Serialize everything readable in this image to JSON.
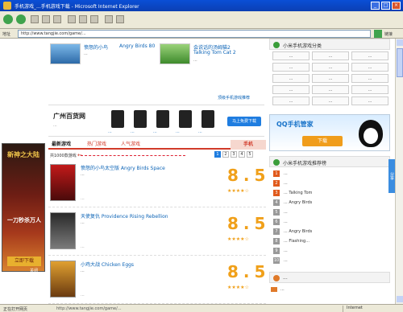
{
  "window": {
    "title": "手机游戏_...手机游戏下载 - Microsoft Internet Explorer",
    "controls": [
      "_",
      "□",
      "×"
    ]
  },
  "address": {
    "label": "地址",
    "url": "http://www.tangjie.com/game/...",
    "links": "链接"
  },
  "left_ad": {
    "logo": "新神之大陆",
    "slogan": "一刀秒杀万人",
    "cta": "立即下载",
    "close": "关闭"
  },
  "top_row": [
    {
      "title": "愤怒的小鸟",
      "subtitle": "Angry Birds 80",
      "desc": "..."
    },
    {
      "title": "会说话的汤姆猫2",
      "subtitle": "Talking Tom Cat 2",
      "desc": "..."
    }
  ],
  "mobile_link": "顶级手机游戏推荐",
  "banner": {
    "brand": "广州百货网",
    "brand_sub": "...",
    "prices": [
      "...",
      "...",
      "...",
      "...",
      "..."
    ],
    "cta": "马上免费下载"
  },
  "tabs": {
    "items": [
      "最新游戏",
      "热门游戏",
      "人气游戏"
    ],
    "active_index": 0,
    "right_label": "手机"
  },
  "pager": {
    "label": "共1000款游戏",
    "pages": [
      "1",
      "2",
      "3",
      "4",
      "5"
    ],
    "active_page": "1"
  },
  "entries": [
    {
      "title": "愤怒的小鸟太空版 Angry Birds Space",
      "desc": "...",
      "meta": "...",
      "score": "8.5",
      "stars": "★★★★☆"
    },
    {
      "title": "天使复仇 Providence Rising Rebellion",
      "desc": "...",
      "meta": "...",
      "score": "8.5",
      "stars": "★★★★☆"
    },
    {
      "title": "小鸡大战 Chicken Eggs",
      "desc": "...",
      "meta": "...",
      "score": "8.5",
      "stars": "★★★★☆"
    }
  ],
  "right_col": {
    "category_head": "小米手机游戏分类",
    "categories": [
      "...",
      "...",
      "...",
      "...",
      "...",
      "...",
      "...",
      "...",
      "...",
      "...",
      "...",
      "...",
      "...",
      "...",
      "..."
    ],
    "qq_ad": {
      "title": "QQ手机管家",
      "cta": "下载"
    },
    "recommend_head": "小米手机游戏推荐榜",
    "recommend": [
      {
        "n": "1",
        "name": "..."
      },
      {
        "n": "2",
        "name": "..."
      },
      {
        "n": "3",
        "name": "... Talking Tom"
      },
      {
        "n": "4",
        "name": "... Angry Birds"
      },
      {
        "n": "5",
        "name": "..."
      },
      {
        "n": "6",
        "name": "..."
      },
      {
        "n": "7",
        "name": "... Angry Birds"
      },
      {
        "n": "8",
        "name": "... Flashing..."
      },
      {
        "n": "9",
        "name": "..."
      },
      {
        "n": "10",
        "name": "..."
      }
    ],
    "box2_head": "...",
    "box2_items": [
      "...",
      "...",
      "..."
    ]
  },
  "side_tab": "分享",
  "status": {
    "text": "正在打开网页",
    "url": "http://www.tangjie.com/game/...",
    "zone": "Internet"
  },
  "colors": {
    "accent_red": "#d13b2a",
    "link_blue": "#0b63b6",
    "score_orange": "#f0a01a"
  }
}
